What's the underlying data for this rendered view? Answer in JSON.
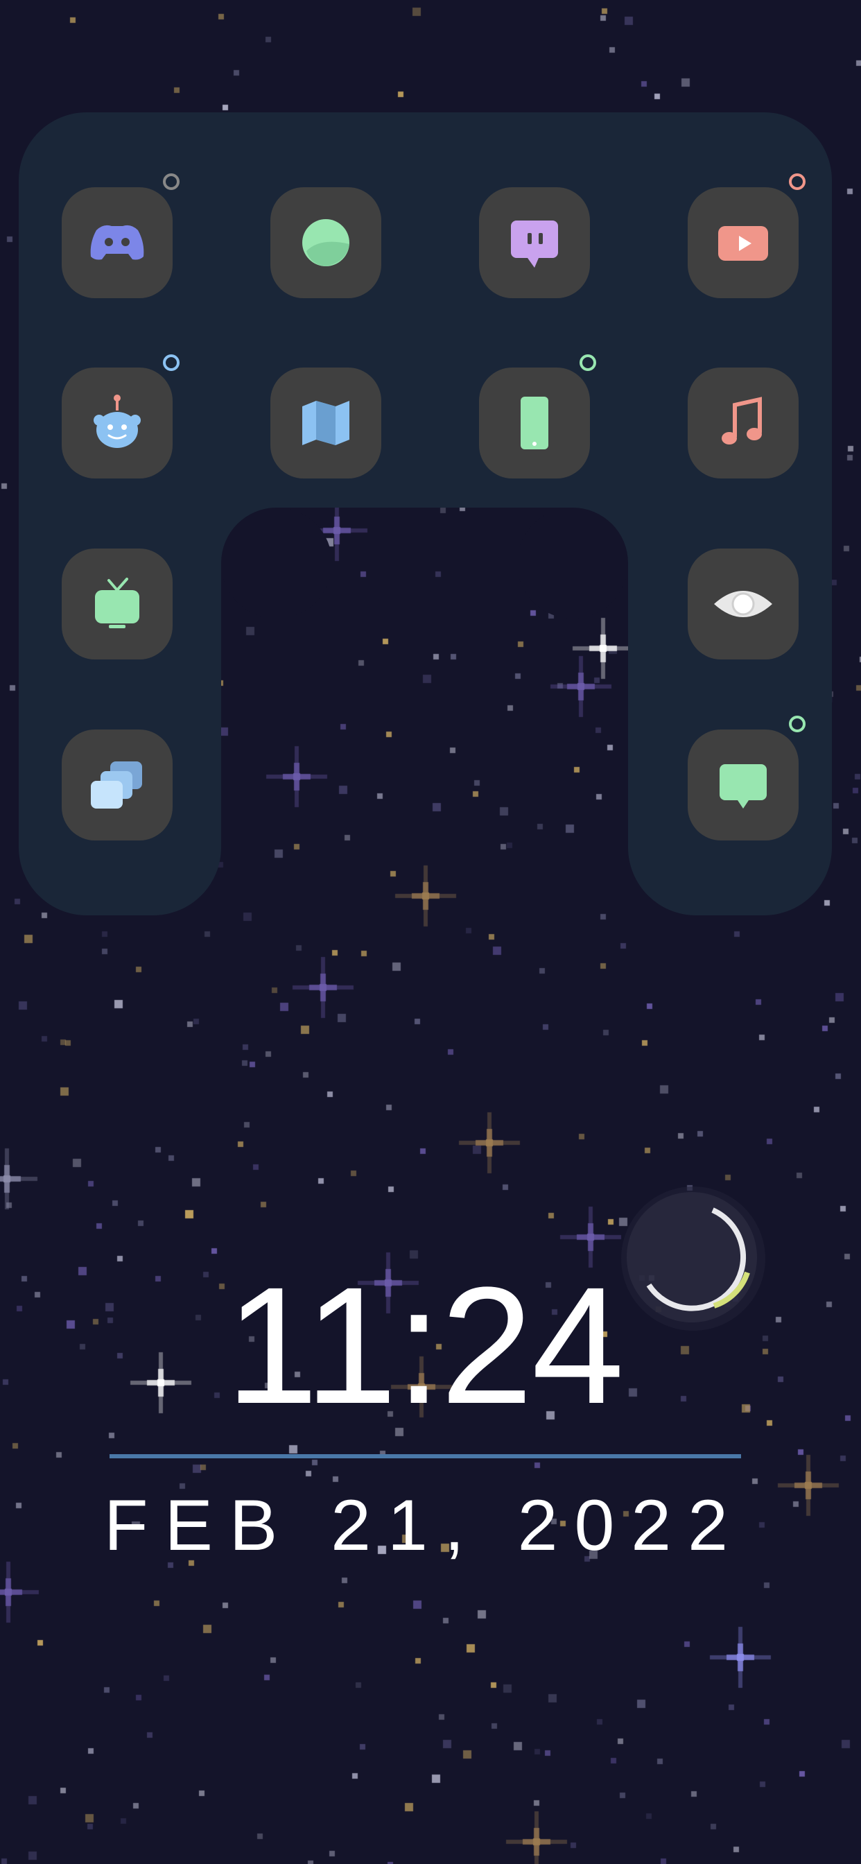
{
  "wallpaper": {
    "background_color": "#14142a",
    "panel_color": "#1a2638",
    "icon_tile_color": "#404040"
  },
  "apps": [
    {
      "icon": "gamepad-icon",
      "app": "discord",
      "color": "#7c86e8",
      "badge": "#888888"
    },
    {
      "icon": "circle-icon",
      "app": "bubble",
      "color": "#98e6b0",
      "badge": null
    },
    {
      "icon": "chat-bubble-icon",
      "app": "twitch",
      "color": "#c9a2ee",
      "badge": null
    },
    {
      "icon": "play-icon",
      "app": "youtube",
      "color": "#f0968a",
      "badge": "#f0968a"
    },
    {
      "icon": "robot-icon",
      "app": "reddit",
      "color": "#8cc2f2",
      "badge": "#8cc2f2"
    },
    {
      "icon": "map-icon",
      "app": "maps",
      "color": "#8cc2f2",
      "badge": null
    },
    {
      "icon": "phone-icon",
      "app": "phone",
      "color": "#98e6b0",
      "badge": "#98e6b0"
    },
    {
      "icon": "music-note-icon",
      "app": "music",
      "color": "#f0968a",
      "badge": null
    },
    {
      "icon": "tv-icon",
      "app": "tv",
      "color": "#98e6b0",
      "badge": null
    },
    {
      "icon": "eye-icon",
      "app": "watch",
      "color": "#e8e8e8",
      "badge": null
    },
    {
      "icon": "stack-icon",
      "app": "gallery",
      "color": "#b8dcfb",
      "badge": null
    },
    {
      "icon": "message-icon",
      "app": "messages",
      "color": "#98e6b0",
      "badge": "#98e6b0"
    }
  ],
  "clock": {
    "time": "11:24",
    "date": "FEB 21, 2022",
    "accent_line_color": "#4a78a8"
  },
  "moon": {
    "icon": "crescent-moon-icon"
  }
}
